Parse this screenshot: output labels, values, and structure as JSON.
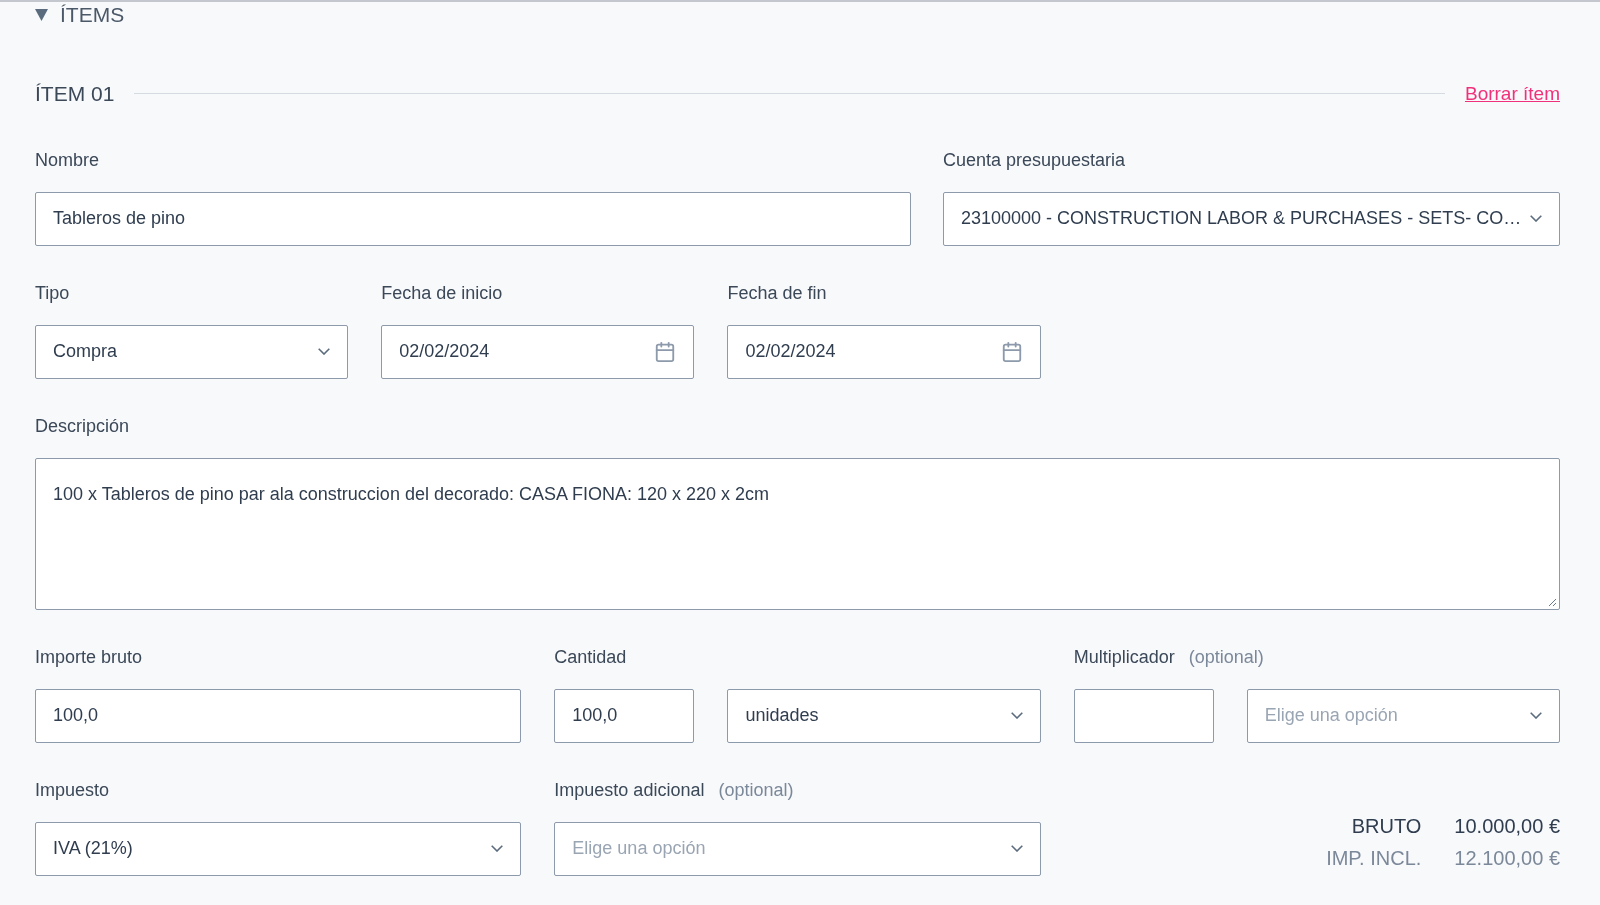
{
  "section": {
    "title": "ÍTEMS",
    "expanded": true
  },
  "item": {
    "title": "ÍTEM 01",
    "delete_link": "Borrar ítem"
  },
  "rows": [
    {
      "groups": [
        {
          "label": "Nombre",
          "fields": [
            {
              "kind": "text",
              "value": "Tableros de pino"
            }
          ]
        },
        {
          "label": "Cuenta presupuestaria",
          "fields": [
            {
              "kind": "select",
              "value": "23100000 - CONSTRUCTION LABOR & PURCHASES -  SETS- CO…"
            }
          ]
        }
      ]
    },
    {
      "groups": [
        {
          "label": "Tipo",
          "fields": [
            {
              "kind": "select",
              "value": "Compra"
            }
          ]
        },
        {
          "label": "Fecha de inicio",
          "fields": [
            {
              "kind": "date",
              "value": "02/02/2024"
            }
          ]
        },
        {
          "label": "Fecha de fin",
          "fields": [
            {
              "kind": "date",
              "value": "02/02/2024"
            }
          ]
        }
      ]
    },
    {
      "groups": [
        {
          "label": "Descripción",
          "fields": [
            {
              "kind": "textarea",
              "value": "100 x Tableros de pino par ala construccion del decorado: CASA FIONA: 120 x 220 x 2cm"
            }
          ]
        }
      ]
    },
    {
      "groups": [
        {
          "label": "Importe bruto",
          "fields": [
            {
              "kind": "text",
              "value": "100,0"
            }
          ]
        },
        {
          "label": "Cantidad",
          "fields": [
            {
              "kind": "text",
              "value": "100,0"
            },
            {
              "kind": "select",
              "value": "unidades"
            }
          ]
        },
        {
          "label": "Multiplicador",
          "optional": "(optional)",
          "fields": [
            {
              "kind": "text"
            },
            {
              "kind": "select",
              "placeholder": "Elige una opción"
            }
          ]
        }
      ]
    },
    {
      "groups": [
        {
          "label": "Impuesto",
          "fields": [
            {
              "kind": "select",
              "value": "IVA (21%)"
            }
          ]
        },
        {
          "label": "Impuesto adicional",
          "optional": "(optional)",
          "fields": [
            {
              "kind": "select",
              "placeholder": "Elige una opción"
            }
          ]
        }
      ]
    }
  ],
  "totals": [
    {
      "label": "BRUTO",
      "value": "10.000,00 €",
      "muted": false
    },
    {
      "label": "IMP. INCL.",
      "value": "12.100,00 €",
      "muted": true
    }
  ]
}
